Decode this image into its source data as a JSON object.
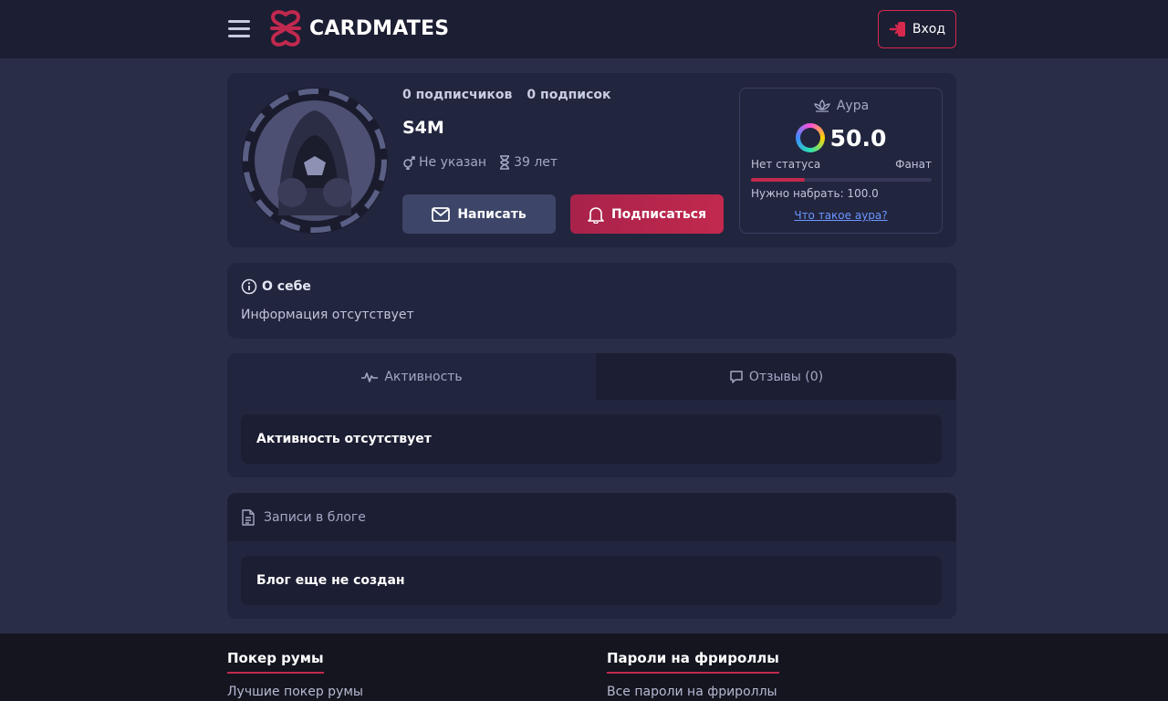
{
  "header": {
    "brand": "CARDMATES",
    "login_label": "Вход"
  },
  "profile": {
    "followers": "0 подписчиков",
    "following": "0 подписок",
    "username": "S4M",
    "gender": "Не указан",
    "age": "39 лет",
    "message_label": "Написать",
    "subscribe_label": "Подписаться"
  },
  "aura": {
    "title": "Аура",
    "score": "50.0",
    "status_current": "Нет статуса",
    "status_next": "Фанат",
    "progress": 0.3,
    "need_text": "Нужно набрать: 100.0",
    "link_text": "Что такое аура?"
  },
  "about": {
    "title": "О себе",
    "text": "Информация отсутствует"
  },
  "tabs": {
    "activity_label": "Активность",
    "reviews_label": "Отзывы (0)",
    "activity_empty": "Активность отсутствует"
  },
  "blog": {
    "title": "Записи в блоге",
    "empty": "Блог еще не создан"
  },
  "footer": {
    "col1_title": "Покер румы",
    "col1_link": "Лучшие покер румы",
    "col2_title": "Пароли на фрироллы",
    "col2_link": "Все пароли на фрироллы"
  },
  "colors": {
    "accent": "#c2294e",
    "page_bg": "#2a2d48",
    "card_bg": "#22253e",
    "header_bg": "#1c1e33",
    "link": "#6b96ff"
  }
}
